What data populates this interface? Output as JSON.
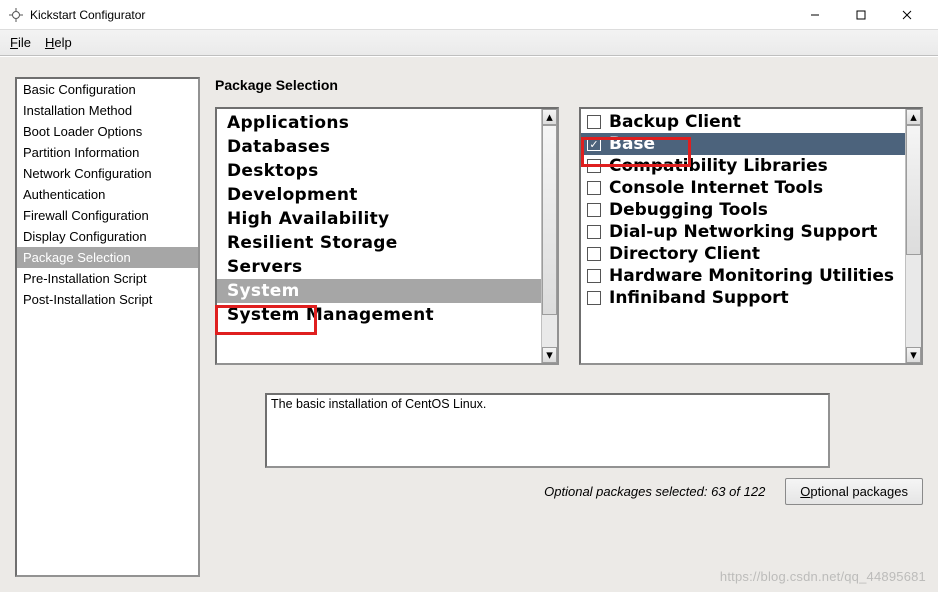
{
  "window": {
    "title": "Kickstart Configurator"
  },
  "menu": {
    "file": "File",
    "help": "Help"
  },
  "sidebar": {
    "items": [
      "Basic Configuration",
      "Installation Method",
      "Boot Loader Options",
      "Partition Information",
      "Network Configuration",
      "Authentication",
      "Firewall Configuration",
      "Display Configuration",
      "Package Selection",
      "Pre-Installation Script",
      "Post-Installation Script"
    ],
    "selected_index": 8
  },
  "main": {
    "section_title": "Package Selection",
    "categories": [
      "Applications",
      "Databases",
      "Desktops",
      "Development",
      "High Availability",
      "Resilient Storage",
      "Servers",
      "System",
      "System Management"
    ],
    "category_selected_index": 7,
    "packages": [
      {
        "label": "Backup Client",
        "checked": false
      },
      {
        "label": "Base",
        "checked": true
      },
      {
        "label": "Compatibility Libraries",
        "checked": false
      },
      {
        "label": "Console Internet Tools",
        "checked": false
      },
      {
        "label": "Debugging Tools",
        "checked": false
      },
      {
        "label": "Dial-up Networking Support",
        "checked": false
      },
      {
        "label": "Directory Client",
        "checked": false
      },
      {
        "label": "Hardware Monitoring Utilities",
        "checked": false
      },
      {
        "label": "Infiniband Support",
        "checked": false
      }
    ],
    "package_selected_index": 1,
    "description": "The basic installation of CentOS Linux.",
    "optional_count_text": "Optional packages selected: 63 of 122",
    "optional_button": "Optional packages"
  },
  "watermark": "https://blog.csdn.net/qq_44895681"
}
